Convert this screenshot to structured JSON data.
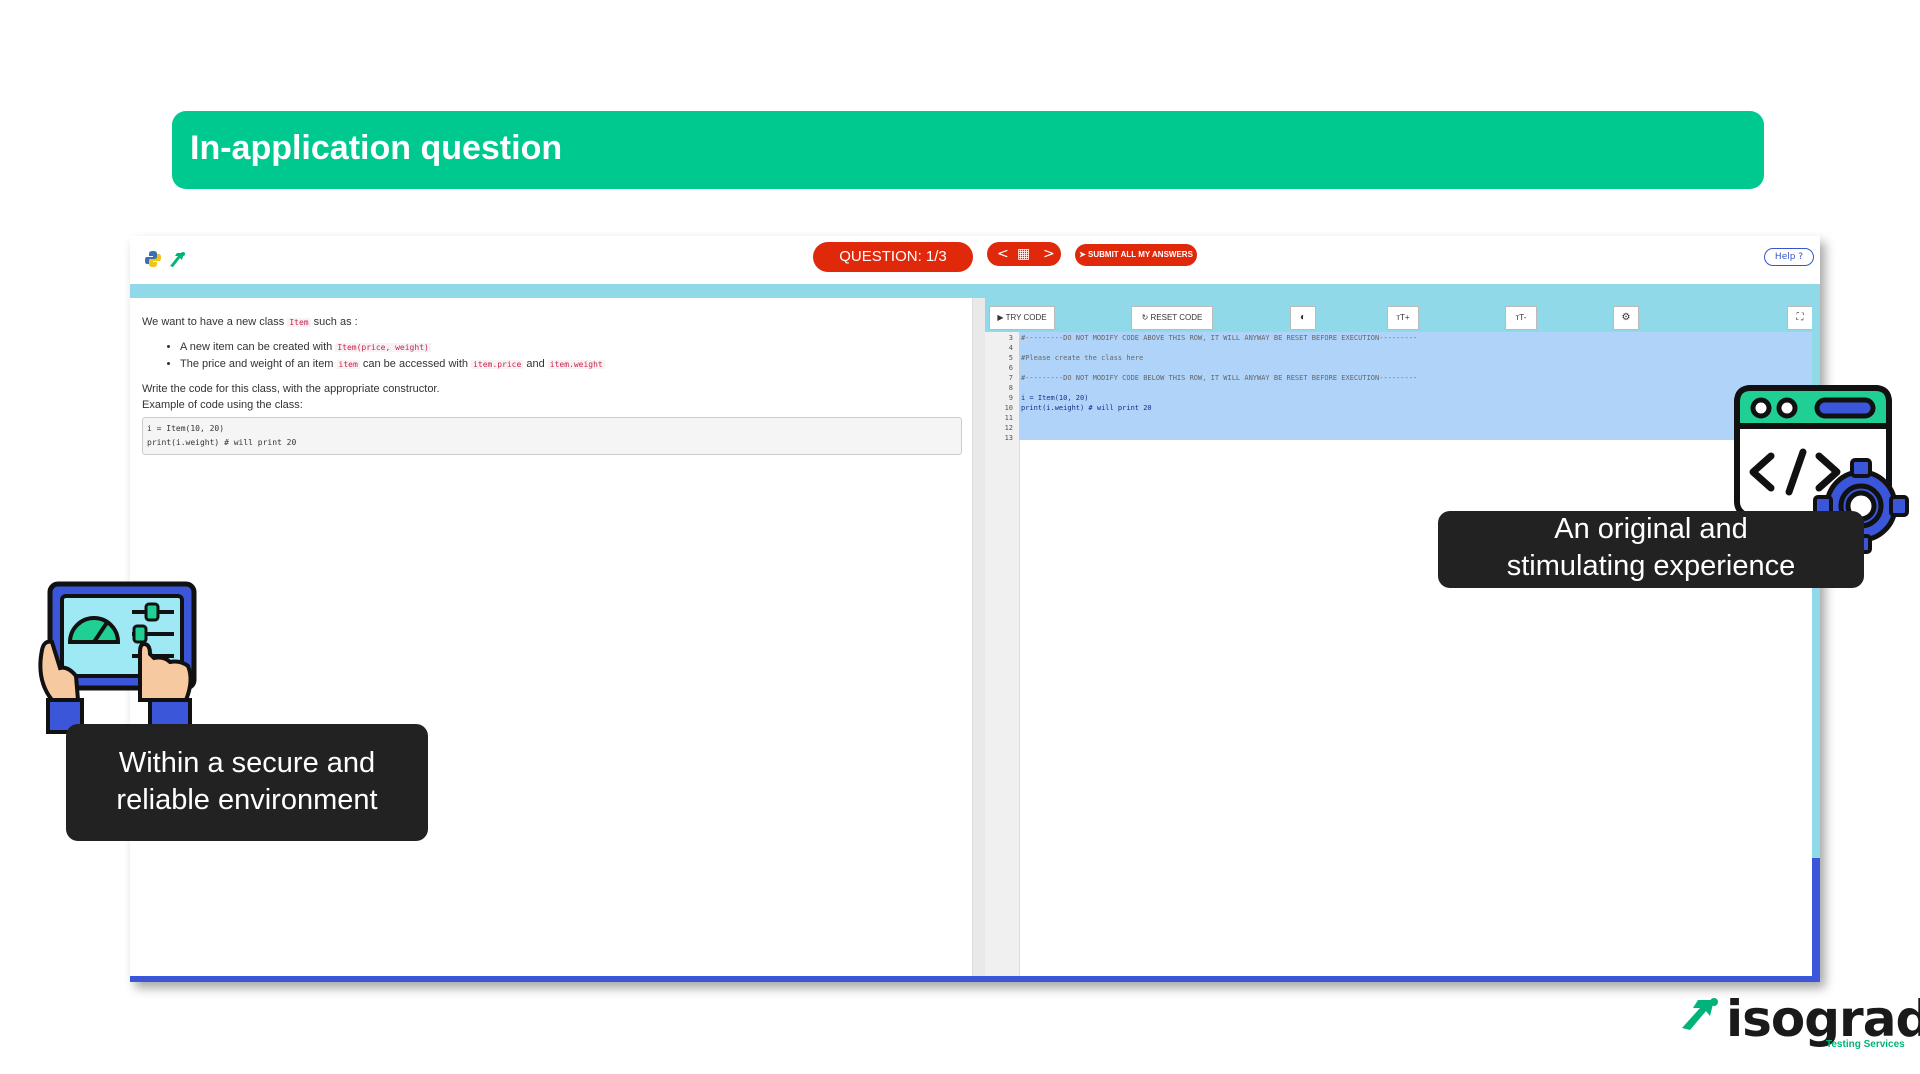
{
  "banner": {
    "title": "In-application question"
  },
  "app": {
    "question_label": "QUESTION: 1/3",
    "prev_glyph": "<",
    "grid_glyph": "▦",
    "next_glyph": ">",
    "submit_label": "SUBMIT ALL MY ANSWERS",
    "help_label": "Help ?",
    "colors": {
      "accent": "#e0290b",
      "strip": "#8fd9e8",
      "brand_green": "#00c98f",
      "border_blue": "#3b56d8"
    }
  },
  "task": {
    "intro_pre": "We want to have a new class",
    "intro_code": "Item",
    "intro_post": "such as :",
    "bullet1_pre": "A new item can be created with",
    "bullet1_code": "Item(price, weight)",
    "bullet2_pre": "The price and weight of an item",
    "bullet2_code1": "item",
    "bullet2_mid": "can be accessed with",
    "bullet2_code2": "item.price",
    "bullet2_and": "and",
    "bullet2_code3": "item.weight",
    "instruction": "Write the code for this class, with the appropriate constructor.",
    "example_label": "Example of code using the class:",
    "example_line1": "i = Item(10, 20)",
    "example_line2": "print(i.weight) # will print 20"
  },
  "toolbar": {
    "try_label": "▶ TRY CODE",
    "reset_label": "↻ RESET CODE",
    "contrast_icon": "◐",
    "font_up_label": "ᴛT+",
    "font_down_label": "ᴛT-",
    "settings_icon": "⚙",
    "fullscreen_icon": "⛶"
  },
  "editor": {
    "line_numbers": [
      "3",
      "4",
      "5",
      "6",
      "7",
      "8",
      "9",
      "10",
      "11",
      "12",
      "13"
    ],
    "line3": "#---------DO NOT MODIFY CODE ABOVE THIS ROW, IT WILL ANYWAY BE RESET BEFORE EXECUTION---------",
    "line5": "#Please create the class here",
    "line7": "#---------DO NOT MODIFY CODE BELOW THIS ROW, IT WILL ANYWAY BE RESET BEFORE EXECUTION---------",
    "line9": "i = Item(10, 20)",
    "line10": "print(i.weight) # will print 20"
  },
  "callouts": {
    "right_line1": "An original and",
    "right_line2": "stimulating experience",
    "left_line1": "Within a secure and",
    "left_line2": "reliable environment"
  },
  "brand": {
    "name": "isograd",
    "subtitle": "Testing Services"
  }
}
